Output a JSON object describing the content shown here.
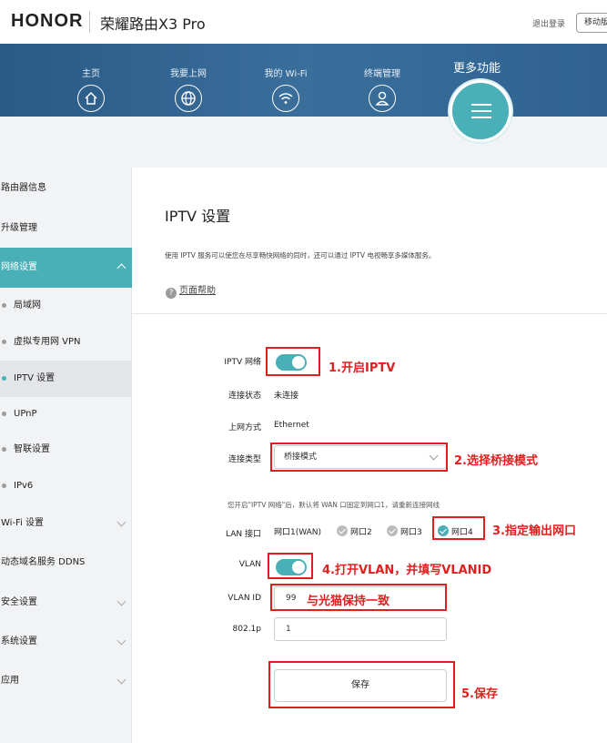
{
  "header": {
    "brand": "HONOR",
    "product": "荣耀路由X3 Pro",
    "logout": "退出登录",
    "mobile": "移动版"
  },
  "nav": {
    "items": [
      {
        "label": "主页",
        "icon": "home-icon"
      },
      {
        "label": "我要上网",
        "icon": "globe-icon"
      },
      {
        "label": "我的 Wi-Fi",
        "icon": "wifi-icon"
      },
      {
        "label": "终端管理",
        "icon": "user-icon"
      }
    ],
    "more_label": "更多功能",
    "more_icon": "menu-icon"
  },
  "sidebar": {
    "items": [
      {
        "label": "路由器信息"
      },
      {
        "label": "升级管理"
      },
      {
        "label": "网络设置",
        "active": true
      },
      {
        "label": "局域网"
      },
      {
        "label": "虚拟专用网 VPN"
      },
      {
        "label": "IPTV 设置",
        "active": true
      },
      {
        "label": "UPnP"
      },
      {
        "label": "智联设置"
      },
      {
        "label": "IPv6"
      },
      {
        "label": "Wi-Fi 设置"
      },
      {
        "label": "动态域名服务 DDNS"
      },
      {
        "label": "安全设置"
      },
      {
        "label": "系统设置"
      },
      {
        "label": "应用"
      }
    ]
  },
  "page": {
    "title": "IPTV 设置",
    "description": "使用 IPTV 服务可以使您在尽享畅快网络的同时，还可以通过 IPTV 电视畅享多媒体服务。",
    "help": "页面帮助"
  },
  "form": {
    "iptv_label": "IPTV 网络",
    "status_label": "连接状态",
    "status_value": "未连接",
    "wan_label": "上网方式",
    "wan_value": "Ethernet",
    "type_label": "连接类型",
    "type_value": "桥接模式",
    "note": "您开启\"IPTV 网络\"后，默认将 WAN 口固定到网口1，请重新连接网线",
    "lan_label": "LAN 接口",
    "ports": [
      "网口1(WAN)",
      "网口2",
      "网口3",
      "网口4"
    ],
    "vlan_label": "VLAN",
    "vlanid_label": "VLAN ID",
    "vlanid_value": "99",
    "p8021_label": "802.1p",
    "p8021_value": "1",
    "save_label": "保存"
  },
  "annotations": {
    "a1": "1.开启IPTV",
    "a2": "2.选择桥接模式",
    "a3": "3.指定输出网口",
    "a4": "4.打开VLAN，并填写VLANID",
    "a_vlanid": "与光猫保持一致",
    "a5": "5.保存",
    "color": "#e0201f"
  },
  "colors": {
    "accent": "#4ab0b7",
    "nav_bg": "#2f6290"
  }
}
